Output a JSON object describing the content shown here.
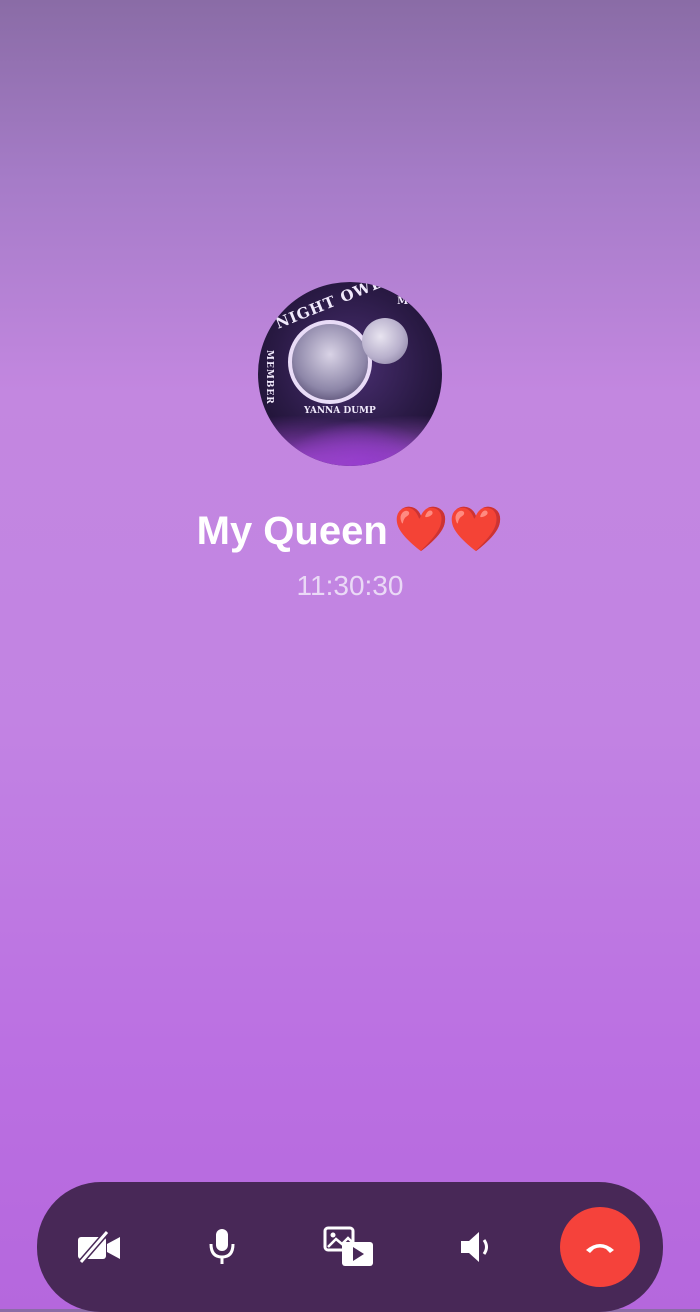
{
  "caller": {
    "name": "My Queen",
    "emoji": "❤️❤️",
    "avatar_text": {
      "arc": "NIGHT OWL",
      "corner": "MON",
      "side": "MEMBER",
      "name": "YANNA DUMP"
    }
  },
  "call": {
    "duration": "11:30:30"
  },
  "controls": {
    "icons": [
      "video-off-icon",
      "microphone-icon",
      "screen-share-icon",
      "speaker-icon",
      "end-call-icon"
    ],
    "end_call_color": "#f5423b",
    "bar_color": "#482857"
  },
  "colors": {
    "background_top": "#8a6ca6",
    "background_bottom": "#b567dd"
  }
}
